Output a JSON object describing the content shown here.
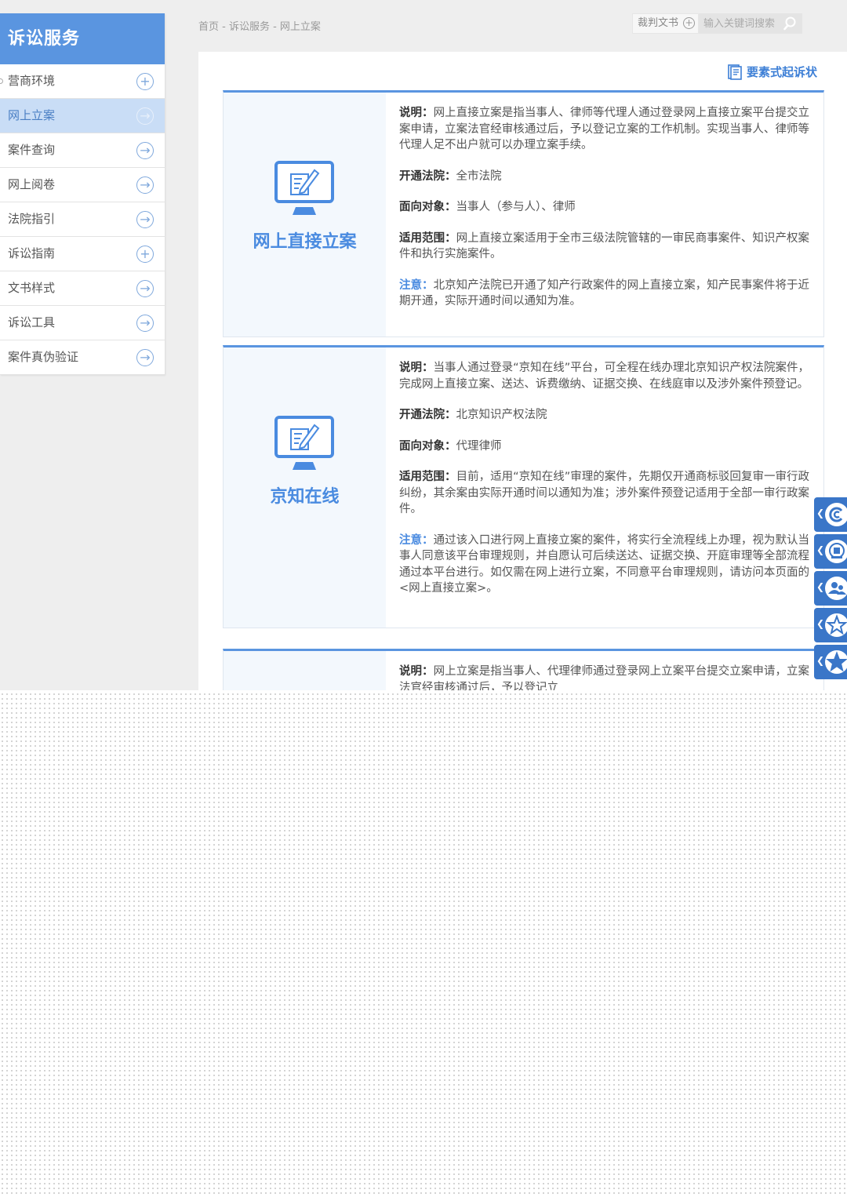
{
  "sidebar": {
    "title": "诉讼服务",
    "items": [
      {
        "label": "营商环境",
        "icon": "plus-circle-icon"
      },
      {
        "label": "网上立案",
        "icon": "arrow-right-circle-icon"
      },
      {
        "label": "案件查询",
        "icon": "arrow-right-circle-icon"
      },
      {
        "label": "网上阅卷",
        "icon": "arrow-right-circle-icon"
      },
      {
        "label": "法院指引",
        "icon": "arrow-right-circle-icon"
      },
      {
        "label": "诉讼指南",
        "icon": "plus-circle-icon"
      },
      {
        "label": "文书样式",
        "icon": "arrow-right-circle-icon"
      },
      {
        "label": "诉讼工具",
        "icon": "arrow-right-circle-icon"
      },
      {
        "label": "案件真伪验证",
        "icon": "arrow-right-circle-icon"
      }
    ],
    "active_label": "网上立案"
  },
  "breadcrumb": "首页 - 诉讼服务 - 网上立案",
  "search": {
    "category": "裁判文书",
    "placeholder": "输入关键词搜索"
  },
  "element_link": "要素式起诉状",
  "cards": [
    {
      "title": "网上直接立案",
      "desc_label": "说明：",
      "desc": "网上直接立案是指当事人、律师等代理人通过登录网上直接立案平台提交立案申请，立案法官经审核通过后，予以登记立案的工作机制。实现当事人、律师等代理人足不出户就可以办理立案手续。",
      "court_label": "开通法院：",
      "court": "全市法院",
      "target_label": "面向对象：",
      "target": "当事人（参与人）、律师",
      "scope_label": "适用范围：",
      "scope": "网上直接立案适用于全市三级法院管辖的一审民商事案件、知识产权案件和执行实施案件。",
      "note_label": "注意：",
      "note": "北京知产法院已开通了知产行政案件的网上直接立案，知产民事案件将于近期开通，实际开通时间以通知为准。"
    },
    {
      "title": "京知在线",
      "desc_label": "说明：",
      "desc": "当事人通过登录“京知在线”平台，可全程在线办理北京知识产权法院案件，完成网上直接立案、送达、诉费缴纳、证据交换、在线庭审以及涉外案件预登记。",
      "court_label": "开通法院：",
      "court": "北京知识产权法院",
      "target_label": "面向对象：",
      "target": "代理律师",
      "scope_label": "适用范围：",
      "scope": "目前，适用“京知在线”审理的案件，先期仅开通商标驳回复审一审行政纠纷，其余案由实际开通时间以通知为准；涉外案件预登记适用于全部一审行政案件。",
      "note_label": "注意：",
      "note": "通过该入口进行网上直接立案的案件，将实行全流程线上办理，视为默认当事人同意该平台审理规则，并自愿认可后续送达、证据交换、开庭审理等全部流程通过本平台进行。如仅需在网上进行立案，不同意平台审理规则，请访问本页面的<网上直接立案>。"
    },
    {
      "desc_label": "说明：",
      "desc": "网上立案是指当事人、代理律师通过登录网上立案平台提交立案申请，立案法官经审核通过后，予以登记立"
    }
  ],
  "float_buttons": [
    {
      "icon": "copyright-icon"
    },
    {
      "icon": "court-emblem-icon"
    },
    {
      "icon": "people-icon"
    },
    {
      "icon": "star-icon"
    },
    {
      "icon": "star-icon"
    }
  ],
  "colors": {
    "accent": "#5a95e0",
    "active_bg": "#c9ddf6",
    "float": "#3a76c8"
  }
}
